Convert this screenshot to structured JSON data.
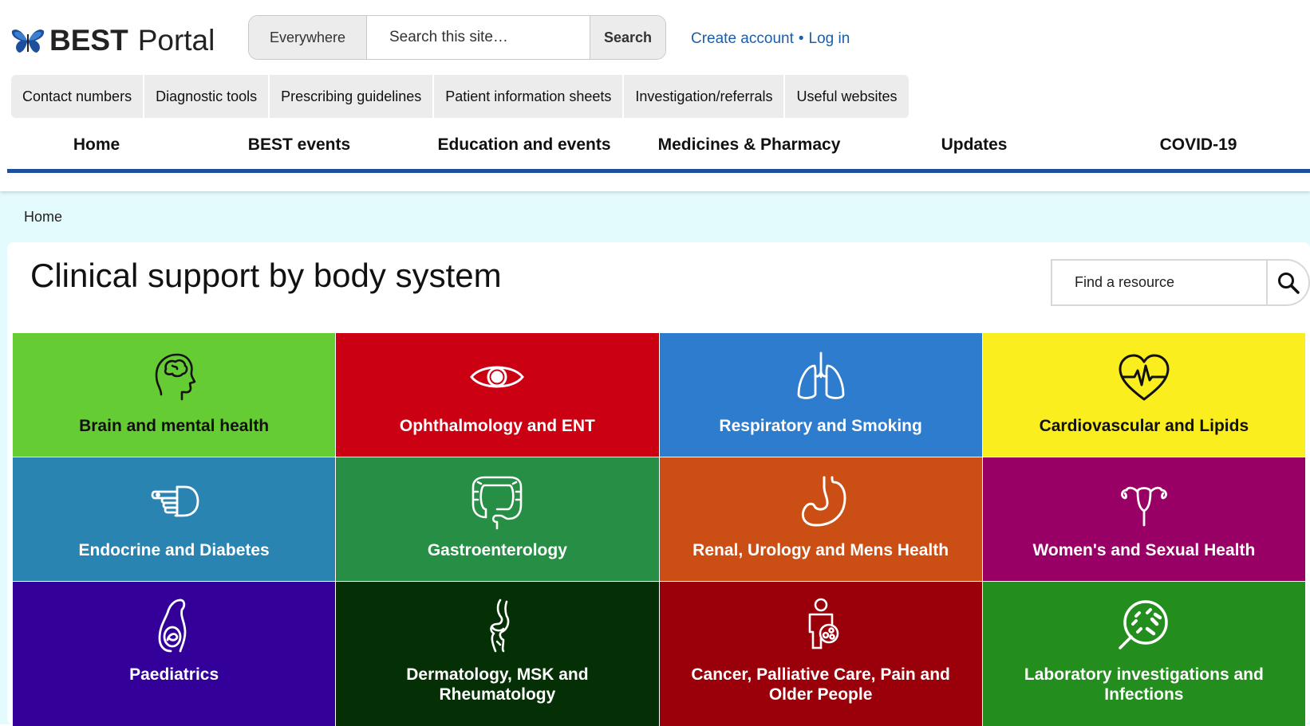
{
  "header": {
    "logo_bold": "BEST",
    "logo_rest": "Portal",
    "search_scope": "Everywhere",
    "search_placeholder": "Search this site…",
    "search_button": "Search",
    "create_account": "Create account",
    "separator": "•",
    "log_in": "Log in"
  },
  "quick_links": [
    "Contact numbers",
    "Diagnostic tools",
    "Prescribing guidelines",
    "Patient information sheets",
    "Investigation/referrals",
    "Useful websites"
  ],
  "main_nav": [
    "Home",
    "BEST events",
    "Education and events",
    "Medicines & Pharmacy",
    "Updates",
    "COVID-19"
  ],
  "breadcrumb": "Home",
  "page": {
    "title": "Clinical support by body system",
    "find_placeholder": "Find a resource"
  },
  "tiles": [
    {
      "label": "Brain and mental health",
      "icon": "brain-head-icon",
      "bg": "#66cc33",
      "fg": "#111111"
    },
    {
      "label": "Ophthalmology and ENT",
      "icon": "eye-icon",
      "bg": "#cc0013",
      "fg": "#ffffff"
    },
    {
      "label": "Respiratory and Smoking",
      "icon": "lungs-icon",
      "bg": "#2d7ccd",
      "fg": "#ffffff"
    },
    {
      "label": "Cardiovascular and Lipids",
      "icon": "heart-pulse-icon",
      "bg": "#fbee1e",
      "fg": "#111111"
    },
    {
      "label": "Endocrine and Diabetes",
      "icon": "finger-prick-icon",
      "bg": "#2a84b2",
      "fg": "#ffffff"
    },
    {
      "label": "Gastroenterology",
      "icon": "intestine-icon",
      "bg": "#278f45",
      "fg": "#ffffff"
    },
    {
      "label": "Renal, Urology and Mens Health",
      "icon": "stomach-icon",
      "bg": "#cb4e15",
      "fg": "#ffffff"
    },
    {
      "label": "Women's and Sexual Health",
      "icon": "uterus-icon",
      "bg": "#990066",
      "fg": "#ffffff"
    },
    {
      "label": "Paediatrics",
      "icon": "pregnancy-icon",
      "bg": "#33009a",
      "fg": "#ffffff"
    },
    {
      "label": "Dermatology, MSK and Rheumatology",
      "icon": "knee-joint-icon",
      "bg": "#053005",
      "fg": "#ffffff"
    },
    {
      "label": "Cancer, Palliative Care, Pain and Older People",
      "icon": "person-tumor-icon",
      "bg": "#9a000a",
      "fg": "#ffffff"
    },
    {
      "label": "Laboratory investigations and Infections",
      "icon": "bacteria-magnifier-icon",
      "bg": "#238d1e",
      "fg": "#ffffff"
    }
  ]
}
